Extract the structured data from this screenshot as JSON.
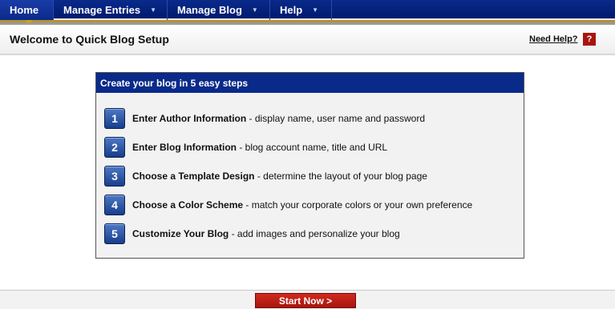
{
  "nav": {
    "items": [
      {
        "label": "Home",
        "has_menu": false
      },
      {
        "label": "Manage Entries",
        "has_menu": true
      },
      {
        "label": "Manage Blog",
        "has_menu": true
      },
      {
        "label": "Help",
        "has_menu": true
      }
    ],
    "menu_arrow": "▼"
  },
  "header": {
    "title": "Welcome to Quick Blog Setup",
    "help_link": "Need Help?",
    "help_icon": "?"
  },
  "steps_box": {
    "heading": "Create your blog in 5 easy steps",
    "steps": [
      {
        "number": "1",
        "title": "Enter Author Information",
        "desc": " - display name, user name and password"
      },
      {
        "number": "2",
        "title": "Enter Blog Information",
        "desc": " - blog account name, title and URL"
      },
      {
        "number": "3",
        "title": "Choose a Template Design",
        "desc": " - determine the layout of your blog page"
      },
      {
        "number": "4",
        "title": "Choose a Color Scheme",
        "desc": " - match your corporate colors or your own preference"
      },
      {
        "number": "5",
        "title": "Customize Your Blog",
        "desc": " - add images and personalize your blog"
      }
    ]
  },
  "footer": {
    "start_label": "Start Now >"
  },
  "colors": {
    "nav_bg": "#0a2a8a",
    "accent_gold": "#b39434",
    "button_red": "#a8150e"
  }
}
